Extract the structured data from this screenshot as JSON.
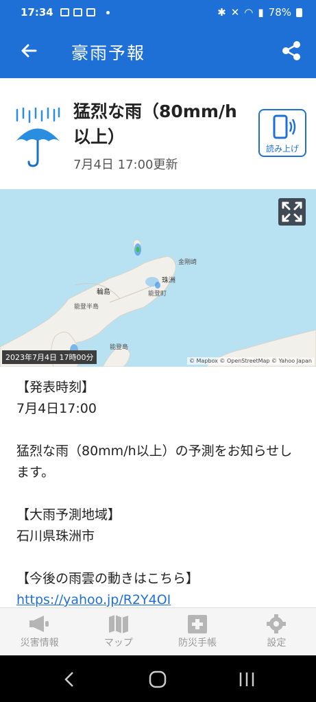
{
  "status_bar": {
    "time": "17:34",
    "battery": "78%"
  },
  "app_bar": {
    "title": "豪雨予報"
  },
  "alert": {
    "headline": "猛烈な雨（80mm/h以上）",
    "updated": "7月4日 17:00更新",
    "read_aloud_label": "読み上げ"
  },
  "map": {
    "timestamp": "2023年7月4日 17時00分",
    "attribution": "© Mapbox © OpenStreetMap © Yahoo Japan",
    "labels": {
      "kyosakisaki": "金剛崎",
      "suzu": "珠洲",
      "wajima": "輪島",
      "noto_peninsula": "能登半島",
      "noto_town": "能登町",
      "noto_island": "能登島"
    }
  },
  "details": {
    "issue_time_heading": "【発表時刻】",
    "issue_time": "7月4日17:00",
    "message": "猛烈な雨（80mm/h以上）の予測をお知らせします。",
    "area_heading": "【大雨予測地域】",
    "area": "石川県珠洲市",
    "link_heading": "【今後の雨雲の動きはこちら】",
    "link": "https://yahoo.jp/R2Y4OI"
  },
  "bottom_nav": [
    {
      "label": "災害情報",
      "icon": "megaphone-icon"
    },
    {
      "label": "マップ",
      "icon": "map-icon"
    },
    {
      "label": "防災手帳",
      "icon": "first-aid-notebook-icon"
    },
    {
      "label": "設定",
      "icon": "gear-icon"
    }
  ],
  "colors": {
    "primary": "#1e6fd6",
    "sea": "#b8e2f2",
    "land": "#f2f0ea"
  }
}
